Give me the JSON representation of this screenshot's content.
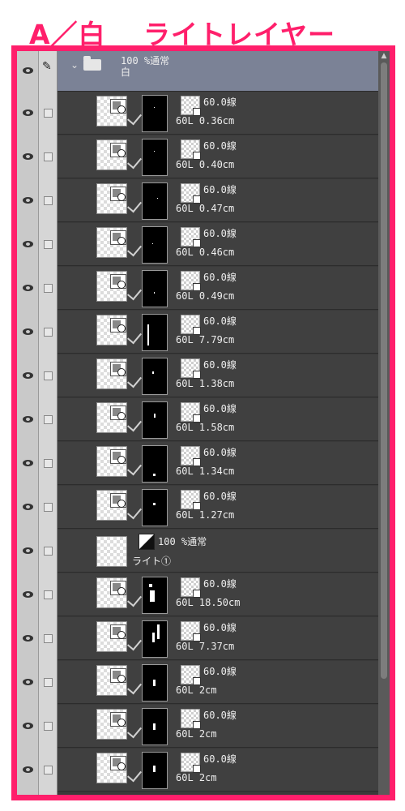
{
  "title": "A／白＿ ライトレイヤー",
  "folder": {
    "opacity_blend": "100 %通常",
    "name": "白"
  },
  "layers": [
    {
      "kind": "normal",
      "line": "60.0線",
      "info": "60L 0.36cm"
    },
    {
      "kind": "normal",
      "line": "60.0線",
      "info": "60L 0.40cm"
    },
    {
      "kind": "normal",
      "line": "60.0線",
      "info": "60L 0.47cm"
    },
    {
      "kind": "normal",
      "line": "60.0線",
      "info": "60L 0.46cm"
    },
    {
      "kind": "normal",
      "line": "60.0線",
      "info": "60L 0.49cm"
    },
    {
      "kind": "normal",
      "line": "60.0線",
      "info": "60L 7.79cm"
    },
    {
      "kind": "normal",
      "line": "60.0線",
      "info": "60L 1.38cm"
    },
    {
      "kind": "normal",
      "line": "60.0線",
      "info": "60L 1.58cm"
    },
    {
      "kind": "normal",
      "line": "60.0線",
      "info": "60L 1.34cm"
    },
    {
      "kind": "normal",
      "line": "60.0線",
      "info": "60L 1.27cm"
    },
    {
      "kind": "light",
      "line": "100 %通常",
      "info": "ライト①"
    },
    {
      "kind": "normal",
      "line": "60.0線",
      "info": "60L 18.50cm"
    },
    {
      "kind": "normal",
      "line": "60.0線",
      "info": "60L 7.37cm"
    },
    {
      "kind": "normal",
      "line": "60.0線",
      "info": "60L 2cm"
    },
    {
      "kind": "normal",
      "line": "60.0線",
      "info": "60L 2cm"
    },
    {
      "kind": "normal",
      "line": "60.0線",
      "info": "60L 2cm"
    }
  ],
  "colors": {
    "accent": "#ff1f6b",
    "folder_row": "#7b8296",
    "layer_row": "#404040"
  }
}
